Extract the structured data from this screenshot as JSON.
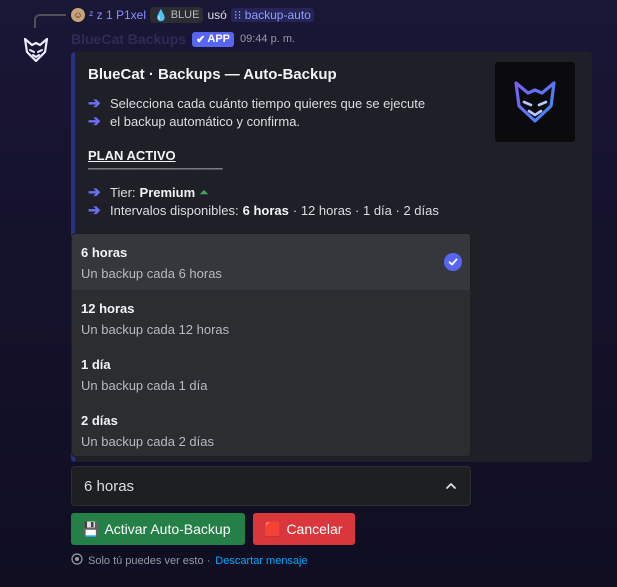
{
  "reply": {
    "username": "ᶻ z 1 P1xel",
    "tag": "BLUE",
    "used_text": "usó",
    "command": "backup-auto"
  },
  "message": {
    "bot_name": "BlueCat Backups",
    "app_badge": "APP",
    "timestamp": "09:44 p. m."
  },
  "embed": {
    "title": "BlueCat · Backups — Auto-Backup",
    "description_line1": "Selecciona cada cuánto tiempo quieres que se ejecute",
    "description_line2": "el backup automático y confirma.",
    "plan_heading": "PLAN ACTIVO",
    "separator": "───────────────────",
    "tier_label": "Tier:",
    "tier_value": "Premium",
    "intervals_label": "Intervalos disponibles:",
    "intervals_selected": "6 horas",
    "intervals_rest": "· 12 horas · 1 día · 2 días"
  },
  "dropdown": {
    "options": [
      {
        "label": "6 horas",
        "description": "Un backup cada 6 horas",
        "selected": true
      },
      {
        "label": "12 horas",
        "description": "Un backup cada 12 horas",
        "selected": false
      },
      {
        "label": "1 día",
        "description": "Un backup cada 1 día",
        "selected": false
      },
      {
        "label": "2 días",
        "description": "Un backup cada 2 días",
        "selected": false
      }
    ]
  },
  "select": {
    "value": "6 horas"
  },
  "buttons": {
    "activate_label": "Activar Auto-Backup",
    "activate_emoji": "💾",
    "cancel_label": "Cancelar",
    "cancel_emoji": "🟥"
  },
  "footer": {
    "visibility_text": "Solo tú puedes ver esto ·",
    "dismiss_link": "Descartar mensaje"
  },
  "colors": {
    "accent": "#5865f2",
    "embed_border": "#2b2f86",
    "success": "#248046",
    "danger": "#da373c",
    "link": "#00a8fc"
  }
}
